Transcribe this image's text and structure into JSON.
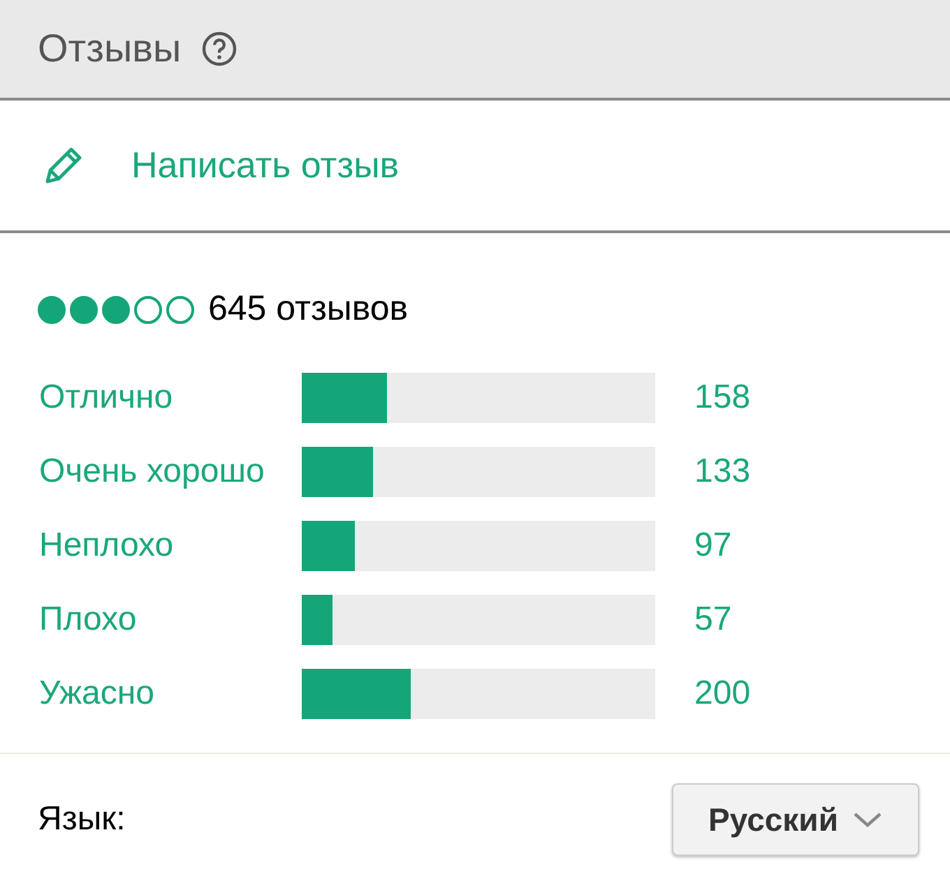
{
  "header": {
    "title": "Отзывы"
  },
  "write_review": {
    "label": "Написать отзыв"
  },
  "summary": {
    "stars": 3,
    "count": "645 отзывов"
  },
  "breakdown": [
    {
      "label": "Отлично",
      "level": 0.24,
      "count": "158"
    },
    {
      "label": "Очень хорошо",
      "level": 0.2,
      "count": "133"
    },
    {
      "label": "Неплохо",
      "level": 0.15,
      "count": "97"
    },
    {
      "label": "Плохо",
      "level": 0.087,
      "count": "57"
    },
    {
      "label": "Ужасно",
      "level": 0.31,
      "count": "200"
    }
  ],
  "language": {
    "label": "Язык:",
    "value": "Русский"
  }
}
